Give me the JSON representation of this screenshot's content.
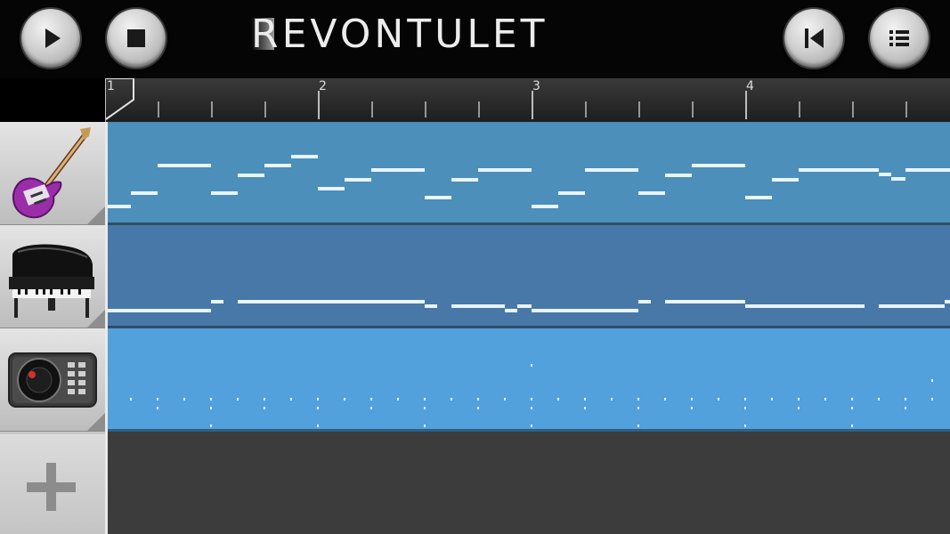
{
  "app": {
    "title": "REVONTULET"
  },
  "transport": {
    "play_icon": "play-icon",
    "stop_icon": "stop-icon",
    "rewind_icon": "skip-to-start-icon",
    "menu_icon": "list-menu-icon"
  },
  "ruler": {
    "bars": [
      "1",
      "2",
      "3",
      "4"
    ]
  },
  "tracks": [
    {
      "instrument_icon": "electric-guitar-icon",
      "lane_color": "#4b8fba"
    },
    {
      "instrument_icon": "grand-piano-icon",
      "lane_color": "#4878a8"
    },
    {
      "instrument_icon": "drum-machine-icon",
      "lane_color": "#52a0dc"
    }
  ],
  "add_track": {
    "icon": "plus-icon"
  },
  "colors": {
    "note": "#e8f4ff",
    "empty_lane": "#3c3c3c",
    "header": "#050505"
  }
}
